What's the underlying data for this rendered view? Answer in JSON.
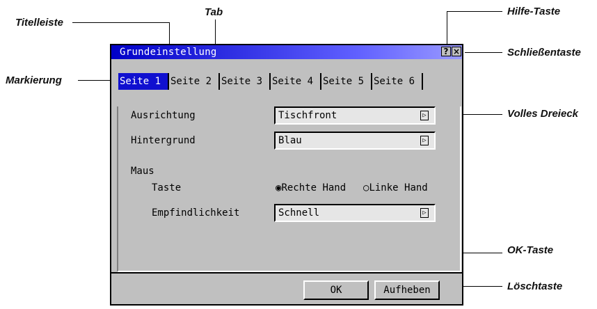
{
  "callouts": {
    "titelleiste": "Titelleiste",
    "tab": "Tab",
    "markierung": "Markierung",
    "hilfe_taste": "Hilfe-Taste",
    "schliessentaste": "Schließentaste",
    "volles_dreieck": "Volles Dreieck",
    "ok_taste": "OK-Taste",
    "loeschtaste": "Löschtaste"
  },
  "window": {
    "title": "Grundeinstellung",
    "help_glyph": "?",
    "close_glyph": "×"
  },
  "tabs": [
    "Seite 1",
    "Seite 2",
    "Seite 3",
    "Seite 4",
    "Seite 5",
    "Seite 6"
  ],
  "form": {
    "ausrichtung_label": "Ausrichtung",
    "ausrichtung_value": "Tischfront",
    "hintergrund_label": "Hintergrund",
    "hintergrund_value": "Blau",
    "maus_label": "Maus",
    "taste_label": "Taste",
    "radio_options": [
      "Rechte Hand",
      "Linke Hand"
    ],
    "radio_selected": "Rechte Hand",
    "empfindlichkeit_label": "Empfindlichkeit",
    "empfindlichkeit_value": "Schnell",
    "arrow_glyph": "▷"
  },
  "buttons": {
    "ok": "OK",
    "aufheben": "Aufheben"
  }
}
